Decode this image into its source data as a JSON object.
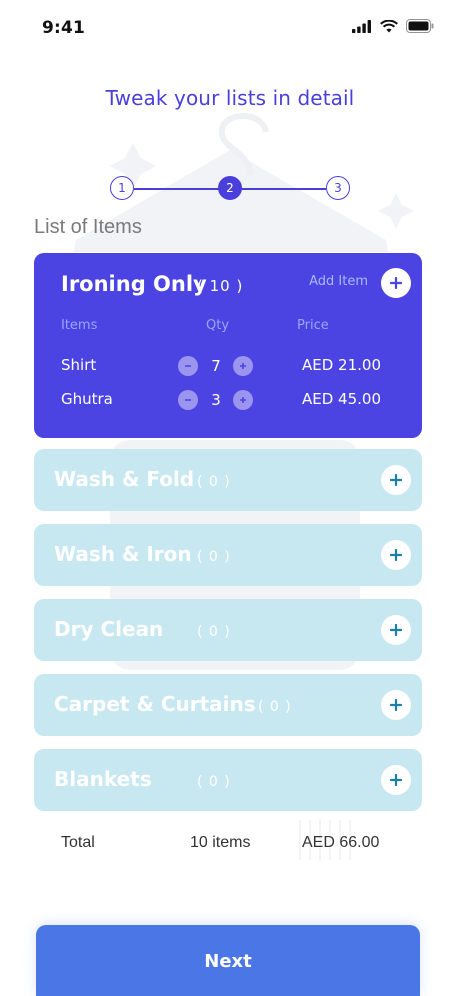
{
  "status_bar": {
    "time": "9:41"
  },
  "page_title": "Tweak your lists in detail",
  "stepper": {
    "steps": [
      "1",
      "2",
      "3"
    ]
  },
  "section_label": "List of Items",
  "active_card": {
    "title": "Ironing Only",
    "count": "( 10 )",
    "add_item_label": "Add Item",
    "columns": {
      "items": "Items",
      "qty": "Qty",
      "price": "Price"
    },
    "rows": [
      {
        "name": "Shirt",
        "qty": "7",
        "price": "AED 21.00"
      },
      {
        "name": "Ghutra",
        "qty": "3",
        "price": "AED 45.00"
      }
    ]
  },
  "categories": [
    {
      "name": "Wash & Fold",
      "count": "( 0 )"
    },
    {
      "name": "Wash & Iron",
      "count": "( 0 )"
    },
    {
      "name": "Dry Clean",
      "count": "( 0 )"
    },
    {
      "name": "Carpet & Curtains",
      "count": "( 0 )"
    },
    {
      "name": "Blankets",
      "count": "( 0 )"
    }
  ],
  "total": {
    "label": "Total",
    "items": "10 items",
    "amount": "AED 66.00"
  },
  "next_button": "Next",
  "colors": {
    "accent": "#4b44e2",
    "inactive_card": "#c7e8f1",
    "button": "#4a77e5"
  }
}
